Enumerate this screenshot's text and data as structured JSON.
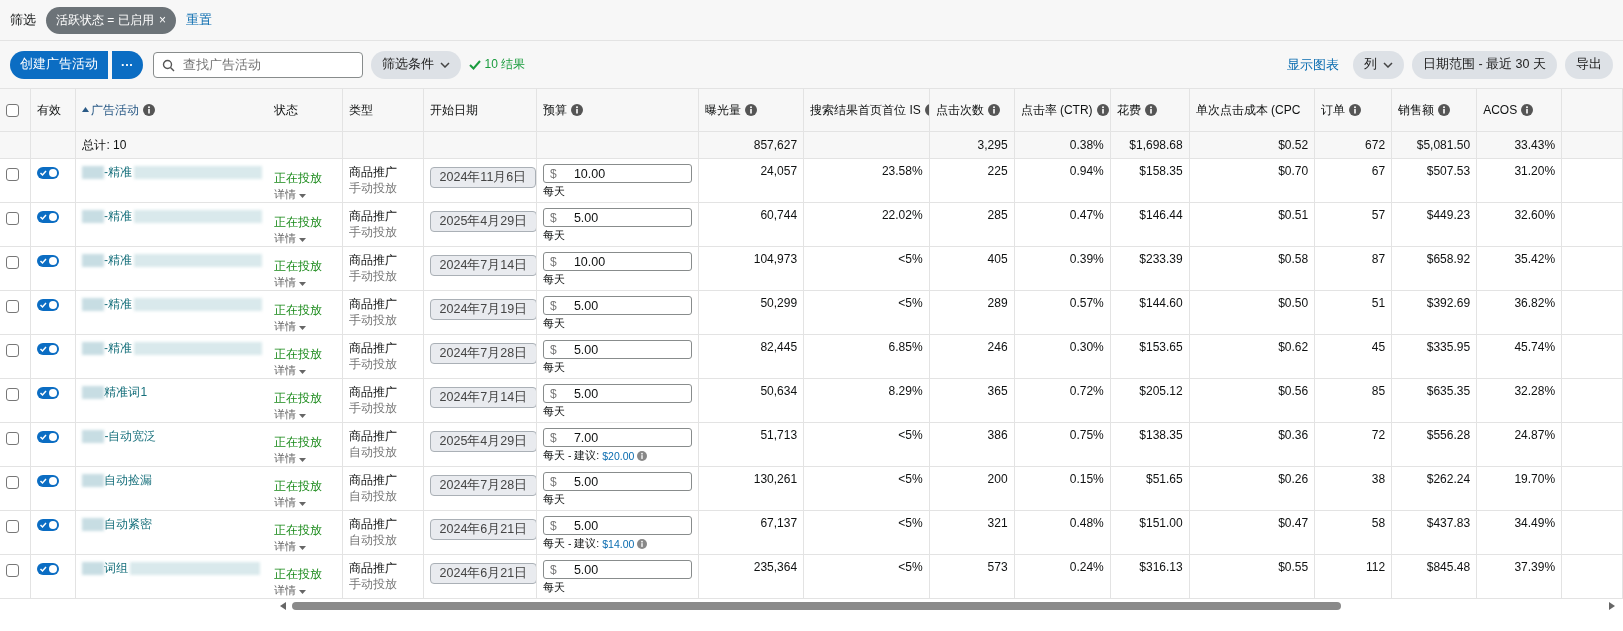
{
  "filter_bar": {
    "label": "筛选",
    "chips": [
      {
        "text": "活跃状态 = 已启用",
        "close": "×"
      }
    ],
    "reset": "重置"
  },
  "toolbar": {
    "create_button": "创建广告活动",
    "more_button": "···",
    "search": {
      "placeholder": "查找广告活动"
    },
    "filter_button": "筛选条件",
    "result_count": "10 结果",
    "show_chart": "显示图表",
    "columns_button": "列",
    "date_range_button": "日期范围 - 最近 30 天",
    "export_button": "导出"
  },
  "table": {
    "select_all": {
      "checked": false
    },
    "columns": [
      {
        "label": "有效",
        "info": false,
        "sorted": false
      },
      {
        "label": "广告活动",
        "info": true,
        "sorted": true
      },
      {
        "label": "状态",
        "info": false,
        "sorted": false
      },
      {
        "label": "类型",
        "info": false,
        "sorted": false
      },
      {
        "label": "开始日期",
        "info": false,
        "sorted": false
      },
      {
        "label": "预算",
        "info": true,
        "sorted": false
      },
      {
        "label": "曝光量",
        "info": true,
        "sorted": false
      },
      {
        "label": "搜索结果首页首位 IS",
        "info": true,
        "sorted": false
      },
      {
        "label": "点击次数",
        "info": true,
        "sorted": false
      },
      {
        "label": "点击率 (CTR)",
        "info": true,
        "sorted": false
      },
      {
        "label": "花费",
        "info": true,
        "sorted": false
      },
      {
        "label": "单次点击成本 (CPC",
        "info": false,
        "sorted": false
      },
      {
        "label": "订单",
        "info": true,
        "sorted": false
      },
      {
        "label": "销售额",
        "info": true,
        "sorted": false
      },
      {
        "label": "ACOS",
        "info": true,
        "sorted": false
      }
    ],
    "totals": {
      "label": "总计: 10",
      "impressions": "857,627",
      "metrics": [
        "3,295",
        "0.38%",
        "$1,698.68",
        "$0.52",
        "672",
        "$5,081.50",
        "33.43%"
      ]
    },
    "rows": [
      {
        "checked": false,
        "enabled": true,
        "name": "-精准",
        "redacted_tail": true,
        "status": "正在投放",
        "details": "详情",
        "type": "商品推广",
        "targeting": "手动投放",
        "start_date": "2024年11月6日",
        "currency": "$",
        "budget": "10.00",
        "budget_period": "每天",
        "suggestion_label": null,
        "suggestion": null,
        "metrics": [
          "24,057",
          "23.58%",
          "225",
          "0.94%",
          "$158.35",
          "$0.70",
          "67",
          "$507.53",
          "31.20%"
        ]
      },
      {
        "checked": false,
        "enabled": true,
        "name": "-精准",
        "redacted_tail": true,
        "status": "正在投放",
        "details": "详情",
        "type": "商品推广",
        "targeting": "手动投放",
        "start_date": "2025年4月29日",
        "currency": "$",
        "budget": "5.00",
        "budget_period": "每天",
        "suggestion_label": null,
        "suggestion": null,
        "metrics": [
          "60,744",
          "22.02%",
          "285",
          "0.47%",
          "$146.44",
          "$0.51",
          "57",
          "$449.23",
          "32.60%"
        ]
      },
      {
        "checked": false,
        "enabled": true,
        "name": "-精准",
        "redacted_tail": true,
        "status": "正在投放",
        "details": "详情",
        "type": "商品推广",
        "targeting": "手动投放",
        "start_date": "2024年7月14日",
        "currency": "$",
        "budget": "10.00",
        "budget_period": "每天",
        "suggestion_label": null,
        "suggestion": null,
        "metrics": [
          "104,973",
          "<5%",
          "405",
          "0.39%",
          "$233.39",
          "$0.58",
          "87",
          "$658.92",
          "35.42%"
        ]
      },
      {
        "checked": false,
        "enabled": true,
        "name": "-精准",
        "redacted_tail": true,
        "status": "正在投放",
        "details": "详情",
        "type": "商品推广",
        "targeting": "手动投放",
        "start_date": "2024年7月19日",
        "currency": "$",
        "budget": "5.00",
        "budget_period": "每天",
        "suggestion_label": null,
        "suggestion": null,
        "metrics": [
          "50,299",
          "<5%",
          "289",
          "0.57%",
          "$144.60",
          "$0.50",
          "51",
          "$392.69",
          "36.82%"
        ]
      },
      {
        "checked": false,
        "enabled": true,
        "name": "-精准",
        "redacted_tail": true,
        "status": "正在投放",
        "details": "详情",
        "type": "商品推广",
        "targeting": "手动投放",
        "start_date": "2024年7月28日",
        "currency": "$",
        "budget": "5.00",
        "budget_period": "每天",
        "suggestion_label": null,
        "suggestion": null,
        "metrics": [
          "82,445",
          "6.85%",
          "246",
          "0.30%",
          "$153.65",
          "$0.62",
          "45",
          "$335.95",
          "45.74%"
        ]
      },
      {
        "checked": false,
        "enabled": true,
        "name": "精准词1",
        "redacted_tail": false,
        "status": "正在投放",
        "details": "详情",
        "type": "商品推广",
        "targeting": "手动投放",
        "start_date": "2024年7月14日",
        "currency": "$",
        "budget": "5.00",
        "budget_period": "每天",
        "suggestion_label": null,
        "suggestion": null,
        "metrics": [
          "50,634",
          "8.29%",
          "365",
          "0.72%",
          "$205.12",
          "$0.56",
          "85",
          "$635.35",
          "32.28%"
        ]
      },
      {
        "checked": false,
        "enabled": true,
        "name": "-自动宽泛",
        "redacted_tail": false,
        "status": "正在投放",
        "details": "详情",
        "type": "商品推广",
        "targeting": "自动投放",
        "start_date": "2025年4月29日",
        "currency": "$",
        "budget": "7.00",
        "budget_period": "每天",
        "suggestion_label": "- 建议:",
        "suggestion": "$20.00",
        "metrics": [
          "51,713",
          "<5%",
          "386",
          "0.75%",
          "$138.35",
          "$0.36",
          "72",
          "$556.28",
          "24.87%"
        ]
      },
      {
        "checked": false,
        "enabled": true,
        "name": "自动捡漏",
        "redacted_tail": false,
        "status": "正在投放",
        "details": "详情",
        "type": "商品推广",
        "targeting": "自动投放",
        "start_date": "2024年7月28日",
        "currency": "$",
        "budget": "5.00",
        "budget_period": "每天",
        "suggestion_label": null,
        "suggestion": null,
        "metrics": [
          "130,261",
          "<5%",
          "200",
          "0.15%",
          "$51.65",
          "$0.26",
          "38",
          "$262.24",
          "19.70%"
        ]
      },
      {
        "checked": false,
        "enabled": true,
        "name": "自动紧密",
        "redacted_tail": false,
        "status": "正在投放",
        "details": "详情",
        "type": "商品推广",
        "targeting": "自动投放",
        "start_date": "2024年6月21日",
        "currency": "$",
        "budget": "5.00",
        "budget_period": "每天",
        "suggestion_label": "- 建议:",
        "suggestion": "$14.00",
        "metrics": [
          "67,137",
          "<5%",
          "321",
          "0.48%",
          "$151.00",
          "$0.47",
          "58",
          "$437.83",
          "34.49%"
        ]
      },
      {
        "checked": false,
        "enabled": true,
        "name": "词组",
        "redacted_tail": true,
        "status": "正在投放",
        "details": "详情",
        "type": "商品推广",
        "targeting": "手动投放",
        "start_date": "2024年6月21日",
        "currency": "$",
        "budget": "5.00",
        "budget_period": "每天",
        "suggestion_label": null,
        "suggestion": null,
        "metrics": [
          "235,364",
          "<5%",
          "573",
          "0.24%",
          "$316.13",
          "$0.55",
          "112",
          "$845.48",
          "37.39%"
        ]
      }
    ]
  }
}
